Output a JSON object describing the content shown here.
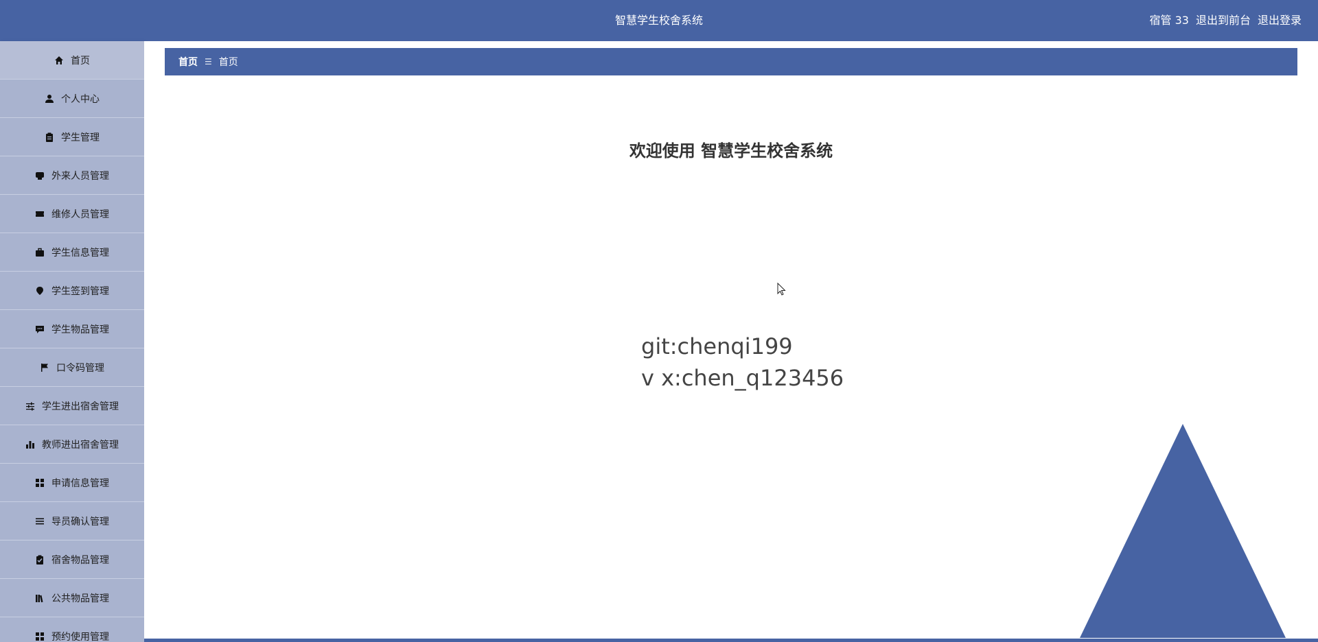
{
  "header": {
    "title": "智慧学生校舍系统",
    "user": "宿管 33",
    "to_front": "退出到前台",
    "logout": "退出登录"
  },
  "sidebar": {
    "items": [
      {
        "label": "首页",
        "icon": "home-icon"
      },
      {
        "label": "个人中心",
        "icon": "user-icon"
      },
      {
        "label": "学生管理",
        "icon": "clipboard-icon"
      },
      {
        "label": "外来人员管理",
        "icon": "tag-icon"
      },
      {
        "label": "维修人员管理",
        "icon": "ticket-icon"
      },
      {
        "label": "学生信息管理",
        "icon": "briefcase-icon"
      },
      {
        "label": "学生签到管理",
        "icon": "location-icon"
      },
      {
        "label": "学生物品管理",
        "icon": "chat-icon"
      },
      {
        "label": "口令码管理",
        "icon": "flag-icon"
      },
      {
        "label": "学生进出宿舍管理",
        "icon": "sliders-icon"
      },
      {
        "label": "教师进出宿舍管理",
        "icon": "bar-chart-icon"
      },
      {
        "label": "申请信息管理",
        "icon": "grid-icon"
      },
      {
        "label": "导员确认管理",
        "icon": "list-icon"
      },
      {
        "label": "宿舍物品管理",
        "icon": "checklist-icon"
      },
      {
        "label": "公共物品管理",
        "icon": "books-icon"
      },
      {
        "label": "预约使用管理",
        "icon": "grid-icon"
      }
    ]
  },
  "breadcrumb": {
    "root": "首页",
    "separator": "☰",
    "current": "首页"
  },
  "main": {
    "welcome": "欢迎使用 智慧学生校舍系统",
    "contact_line1": "git:chenqi199",
    "contact_line2": "v x:chen_q123456"
  },
  "colors": {
    "primary": "#4763a3",
    "sidebar_bg": "#a9b3cf"
  }
}
